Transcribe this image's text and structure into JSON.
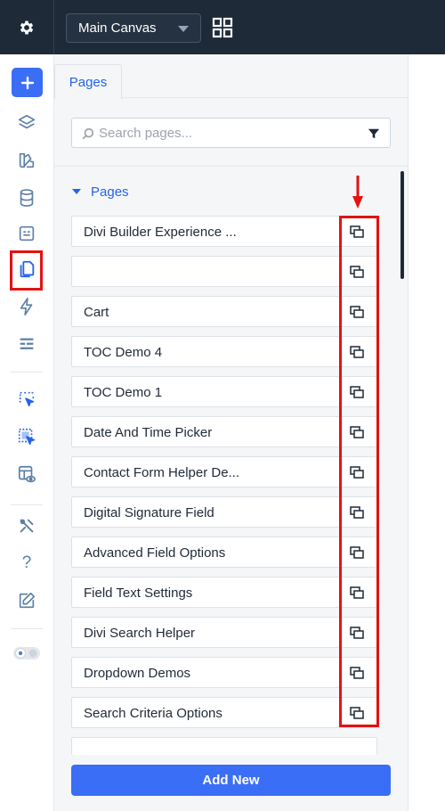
{
  "topbar": {
    "canvas_select": "Main Canvas"
  },
  "rail": {
    "icons": [
      "add-icon",
      "layers-icon",
      "theme-icon",
      "database-icon",
      "form-icon",
      "pages-icon",
      "lightning-icon",
      "rows-icon",
      "click-select-icon",
      "click-select-active-icon",
      "preview-icon",
      "tools-icon",
      "help-icon",
      "edit-icon",
      "toggle-icon"
    ],
    "help_symbol": "?"
  },
  "panel": {
    "tab_label": "Pages",
    "search_placeholder": "Search pages...",
    "section_label": "Pages",
    "pages": [
      "Divi Builder Experience ...",
      "",
      "Cart",
      "TOC Demo 4",
      "TOC Demo 1",
      "Date And Time Picker",
      "Contact Form Helper De...",
      "Digital Signature Field",
      "Advanced Field Options",
      "Field Text Settings",
      "Divi Search Helper",
      "Dropdown Demos",
      "Search Criteria Options",
      ""
    ],
    "add_new_label": "Add New"
  },
  "colors": {
    "topbar": "#1e2a37",
    "accent": "#3b6ef6",
    "annotation": "#e31212"
  }
}
